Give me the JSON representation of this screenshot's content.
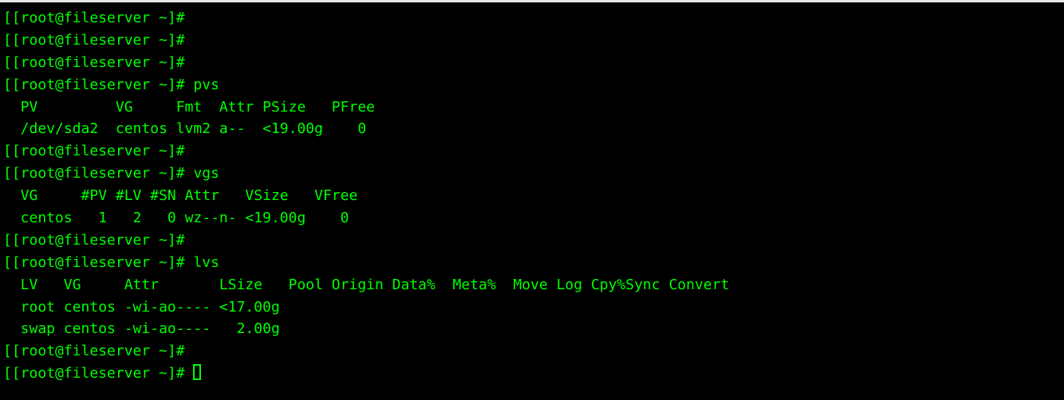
{
  "prompt": "[root@fileserver ~]#",
  "lbracket": "[",
  "commands": {
    "pvs": "pvs",
    "vgs": "vgs",
    "lvs": "lvs"
  },
  "pvs": {
    "header": "  PV         VG     Fmt  Attr PSize   PFree",
    "rows": [
      "  /dev/sda2  centos lvm2 a--  <19.00g    0 "
    ]
  },
  "vgs": {
    "header": "  VG     #PV #LV #SN Attr   VSize   VFree",
    "rows": [
      "  centos   1   2   0 wz--n- <19.00g    0 "
    ]
  },
  "lvs": {
    "header": "  LV   VG     Attr       LSize   Pool Origin Data%  Meta%  Move Log Cpy%Sync Convert",
    "rows": [
      "  root centos -wi-ao---- <17.00g                                                    ",
      "  swap centos -wi-ao----   2.00g                                                    "
    ]
  }
}
